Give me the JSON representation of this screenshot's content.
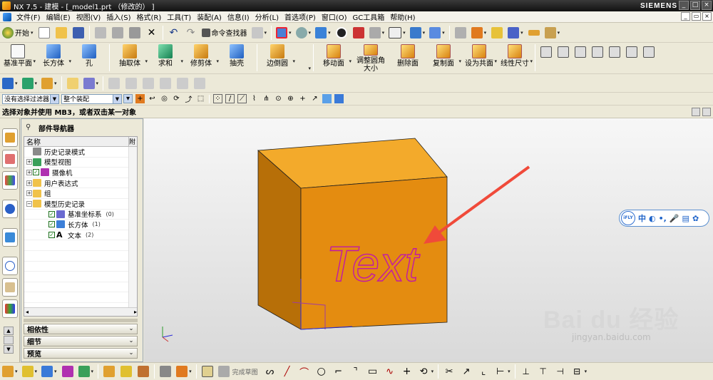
{
  "window": {
    "title": "NX 7.5 - 建模 - [_model1.prt （修改的） ]",
    "brand": "SIEMENS"
  },
  "menu": {
    "items": [
      "文件(F)",
      "编辑(E)",
      "视图(V)",
      "插入(S)",
      "格式(R)",
      "工具(T)",
      "装配(A)",
      "信息(I)",
      "分析(L)",
      "首选项(P)",
      "窗口(O)",
      "GC工具箱",
      "帮助(H)"
    ]
  },
  "toolbar_standard": {
    "start_label": "开始",
    "command_finder_label": "命令查找器"
  },
  "toolbar_feature": {
    "buttons": [
      {
        "label": "基准平面",
        "icon": "datum-plane-icon",
        "color": "#f2f2f2"
      },
      {
        "label": "长方体",
        "icon": "block-icon",
        "color": "#3c7fd8"
      },
      {
        "label": "孔",
        "icon": "hole-icon",
        "color": "#3c7fd8"
      },
      {
        "label": "抽取体",
        "icon": "extract-body-icon",
        "color": "#e3a23c"
      },
      {
        "label": "求和",
        "icon": "unite-icon",
        "color": "#2aa56b"
      },
      {
        "label": "修剪体",
        "icon": "trim-body-icon",
        "color": "#e3a23c"
      },
      {
        "label": "抽壳",
        "icon": "shell-icon",
        "color": "#3c7fd8"
      },
      {
        "label": "边倒圆",
        "icon": "edge-blend-icon",
        "color": "#e3a23c"
      }
    ],
    "sync_buttons": [
      {
        "label": "移动面",
        "icon": "move-face-icon"
      },
      {
        "label": "调整圆角大小",
        "icon": "resize-blend-icon"
      },
      {
        "label": "删除面",
        "icon": "delete-face-icon"
      },
      {
        "label": "复制面",
        "icon": "copy-face-icon"
      },
      {
        "label": "设为共面",
        "icon": "make-coplanar-icon"
      },
      {
        "label": "线性尺寸",
        "icon": "linear-dimension-icon"
      }
    ]
  },
  "selection_bar": {
    "filter_value": "没有选择过滤器",
    "scope_value": "整个装配"
  },
  "status_prompt": "选择对象并使用 MB3，或者双击某一对象",
  "part_navigator": {
    "title": "部件导航器",
    "column_name": "名称",
    "column_2": "附",
    "rows": [
      {
        "text": "历史记录模式",
        "icon": "history-mode-icon",
        "indent": 0,
        "expander": "",
        "checked": false,
        "count": ""
      },
      {
        "text": "模型视图",
        "icon": "model-views-icon",
        "indent": 0,
        "expander": "+",
        "checked": false,
        "count": ""
      },
      {
        "text": "摄像机",
        "icon": "cameras-icon",
        "indent": 0,
        "expander": "+",
        "checked": true,
        "count": ""
      },
      {
        "text": "用户表达式",
        "icon": "folder-icon",
        "indent": 0,
        "expander": "+",
        "checked": false,
        "count": ""
      },
      {
        "text": "组",
        "icon": "folder-icon",
        "indent": 0,
        "expander": "+",
        "checked": false,
        "count": ""
      },
      {
        "text": "模型历史记录",
        "icon": "folder-open-icon",
        "indent": 0,
        "expander": "−",
        "checked": false,
        "count": ""
      },
      {
        "text": "基准坐标系",
        "icon": "datum-csys-icon",
        "indent": 1,
        "expander": "",
        "checked": true,
        "count": "(0)"
      },
      {
        "text": "长方体",
        "icon": "block-icon",
        "indent": 1,
        "expander": "",
        "checked": true,
        "count": "(1)"
      },
      {
        "text": "文本",
        "icon": "text-icon",
        "indent": 1,
        "expander": "",
        "checked": true,
        "count": "(2)"
      }
    ],
    "panels": [
      "相依性",
      "细节",
      "预览"
    ]
  },
  "viewport": {
    "text_on_face": "Text",
    "cube_colors": {
      "top": "#f3aa2b",
      "front": "#e48c10",
      "side": "#b76f08"
    },
    "arrow_color": "#f04a3a",
    "text_outline_color": "#c018a8"
  },
  "ifly_bar": {
    "logo": "iFLY",
    "items": [
      "中",
      "◐",
      "•,",
      "🎤",
      "▤",
      "✿"
    ]
  },
  "watermark": {
    "main": "Bai du 经验",
    "sub": "jingyan.baidu.com"
  },
  "bottom_toolbar": {
    "label": "完成草图"
  }
}
